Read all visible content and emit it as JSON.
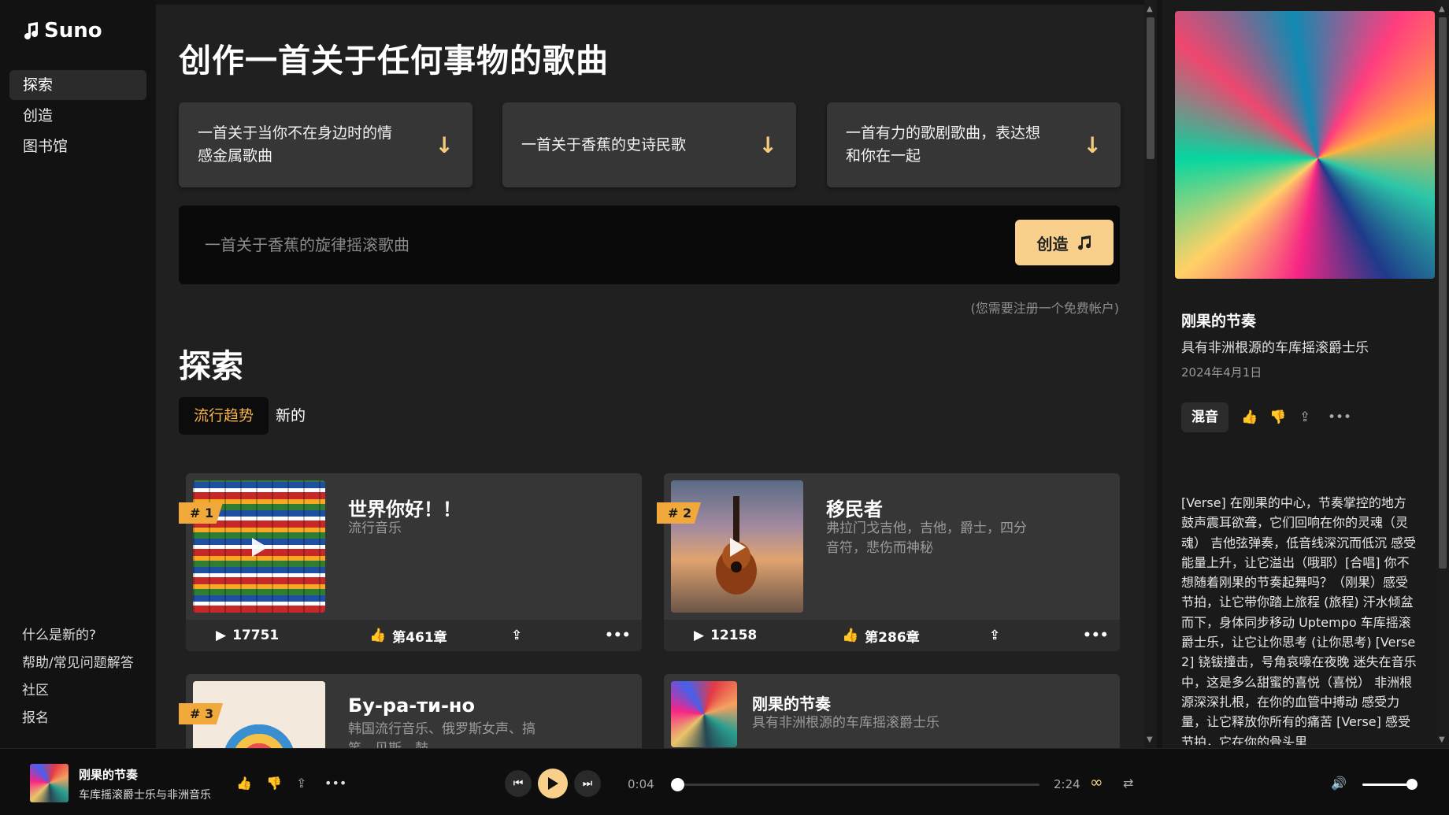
{
  "brand": {
    "name": "Suno"
  },
  "nav": [
    {
      "label": "探索",
      "active": true
    },
    {
      "label": "创造",
      "active": false
    },
    {
      "label": "图书馆",
      "active": false
    }
  ],
  "footer_links": [
    {
      "label": "什么是新的?"
    },
    {
      "label": "帮助/常见问题解答"
    },
    {
      "label": "社区"
    },
    {
      "label": "报名"
    }
  ],
  "hero": {
    "title": "创作一首关于任何事物的歌曲"
  },
  "suggestions": [
    {
      "text": "一首关于当你不在身边时的情感金属歌曲"
    },
    {
      "text": "一首关于香蕉的史诗民歌"
    },
    {
      "text": "一首有力的歌剧歌曲，表达想和你在一起"
    }
  ],
  "prompt": {
    "placeholder": "一首关于香蕉的旋律摇滚歌曲",
    "create_label": "创造",
    "note": "(您需要注册一个免费帐户)"
  },
  "explore": {
    "title": "探索",
    "tabs": [
      {
        "label": "流行趋势",
        "active": true
      },
      {
        "label": "新的",
        "active": false
      }
    ]
  },
  "songs": [
    {
      "rank": "# 1",
      "title": "世界你好！！",
      "genre": "流行音乐",
      "plays": "17751",
      "likes": "第461章"
    },
    {
      "rank": "# 2",
      "title": "移民者",
      "genre": "弗拉门戈吉他，吉他，爵士，四分音符，悲伤而神秘",
      "plays": "12158",
      "likes": "第286章"
    },
    {
      "rank": "# 3",
      "title": "Бу-ра-ти-но",
      "genre": "韩国流行音乐、俄罗斯女声、搞笑、贝斯、鼓"
    },
    {
      "title": "刚果的节奏",
      "genre": "具有非洲根源的车库摇滚爵士乐"
    }
  ],
  "detail": {
    "title": "刚果的节奏",
    "subtitle": "具有非洲根源的车库摇滚爵士乐",
    "date": "2024年4月1日",
    "remix_label": "混音",
    "lyrics": "[Verse] 在刚果的中心，节奏掌控的地方 鼓声震耳欲聋，它们回响在你的灵魂（灵魂） 吉他弦弹奏，低音线深沉而低沉 感受能量上升，让它溢出（哦耶）[合唱] 你不想随着刚果的节奏起舞吗？（刚果）感受节拍，让它带你踏上旅程 (旅程) 汗水倾盆而下，身体同步移动 Uptempo 车库摇滚爵士乐，让它让你思考 (让你思考) [Verse 2] 铙钹撞击，号角哀嚎在夜晚 迷失在音乐中，这是多么甜蜜的喜悦（喜悦） 非洲根源深深扎根，在你的血管中搏动 感受力量，让它释放你所有的痛苦 [Verse] 感受节拍，它在你的骨头里"
  },
  "player": {
    "title": "刚果的节奏",
    "subtitle": "车库摇滚爵士乐与非洲音乐",
    "current_time": "0:04",
    "duration": "2:24",
    "progress": 0.03,
    "volume": 0.85
  },
  "colors": {
    "accent": "#f8d08c",
    "highlight": "#f7b34c",
    "badge": "#f0a93a"
  }
}
